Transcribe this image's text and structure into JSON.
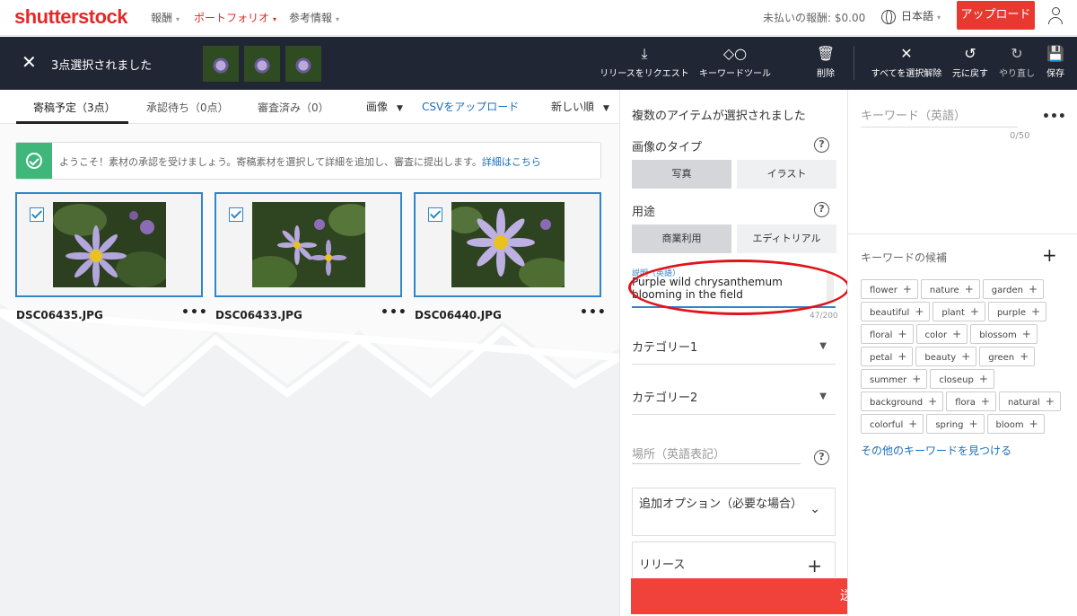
{
  "topnav": {
    "logo": "shutterstock",
    "items": [
      {
        "label": "報酬",
        "active": false
      },
      {
        "label": "ポートフォリオ",
        "active": true
      },
      {
        "label": "参考情報",
        "active": false
      }
    ],
    "earnings": "未払いの報酬: $0.00",
    "language": "日本語",
    "upload": "アップロード"
  },
  "toolbar": {
    "selected": "3点選択されました",
    "buttons": {
      "request_release": "リリースをリクエスト",
      "keyword_tool": "キーワードツール",
      "delete": "削除",
      "deselect_all": "すべてを選択解除",
      "undo": "元に戻す",
      "redo": "やり直し",
      "save": "保存"
    }
  },
  "tabs": {
    "items": [
      {
        "label": "寄稿予定（3点）"
      },
      {
        "label": "承認待ち（0点）"
      },
      {
        "label": "審査済み（0）"
      }
    ],
    "filter_type": "画像",
    "csv": "CSVをアップロード",
    "sort": "新しい順"
  },
  "welcome": {
    "text": "ようこそ！素材の承認を受けましょう。寄稿素材を選択して詳細を追加し、審査に提出します。",
    "link": "詳細はこちら"
  },
  "assets": [
    {
      "filename": "DSC06435.JPG"
    },
    {
      "filename": "DSC06433.JPG"
    },
    {
      "filename": "DSC06440.JPG"
    }
  ],
  "panel": {
    "title": "複数のアイテムが選択されました",
    "image_type_label": "画像のタイプ",
    "image_type_options": [
      "写真",
      "イラスト"
    ],
    "usage_label": "用途",
    "usage_options": [
      "商業利用",
      "エディトリアル"
    ],
    "description_label": "説明（英語）",
    "description": "Purple wild chrysanthemum blooming in the field",
    "description_count": "47/200",
    "category1": "カテゴリー1",
    "category2": "カテゴリー2",
    "location_placeholder": "場所（英語表記）",
    "additional_options": "追加オプション（必要な場合）",
    "release": "リリース",
    "submit": "送信"
  },
  "keywords": {
    "placeholder": "キーワード（英語）",
    "count": "0/50",
    "suggested_label": "キーワードの候補",
    "suggested": [
      "flower",
      "nature",
      "garden",
      "beautiful",
      "plant",
      "purple",
      "floral",
      "color",
      "blossom",
      "petal",
      "beauty",
      "green",
      "summer",
      "closeup",
      "background",
      "flora",
      "natural",
      "colorful",
      "spring",
      "bloom"
    ],
    "more_link": "その他のキーワードを見つける"
  },
  "colors": {
    "brand": "#e22a2a",
    "accent": "#2f87c7",
    "toolbar_bg": "#212634",
    "success": "#3fb67a"
  }
}
